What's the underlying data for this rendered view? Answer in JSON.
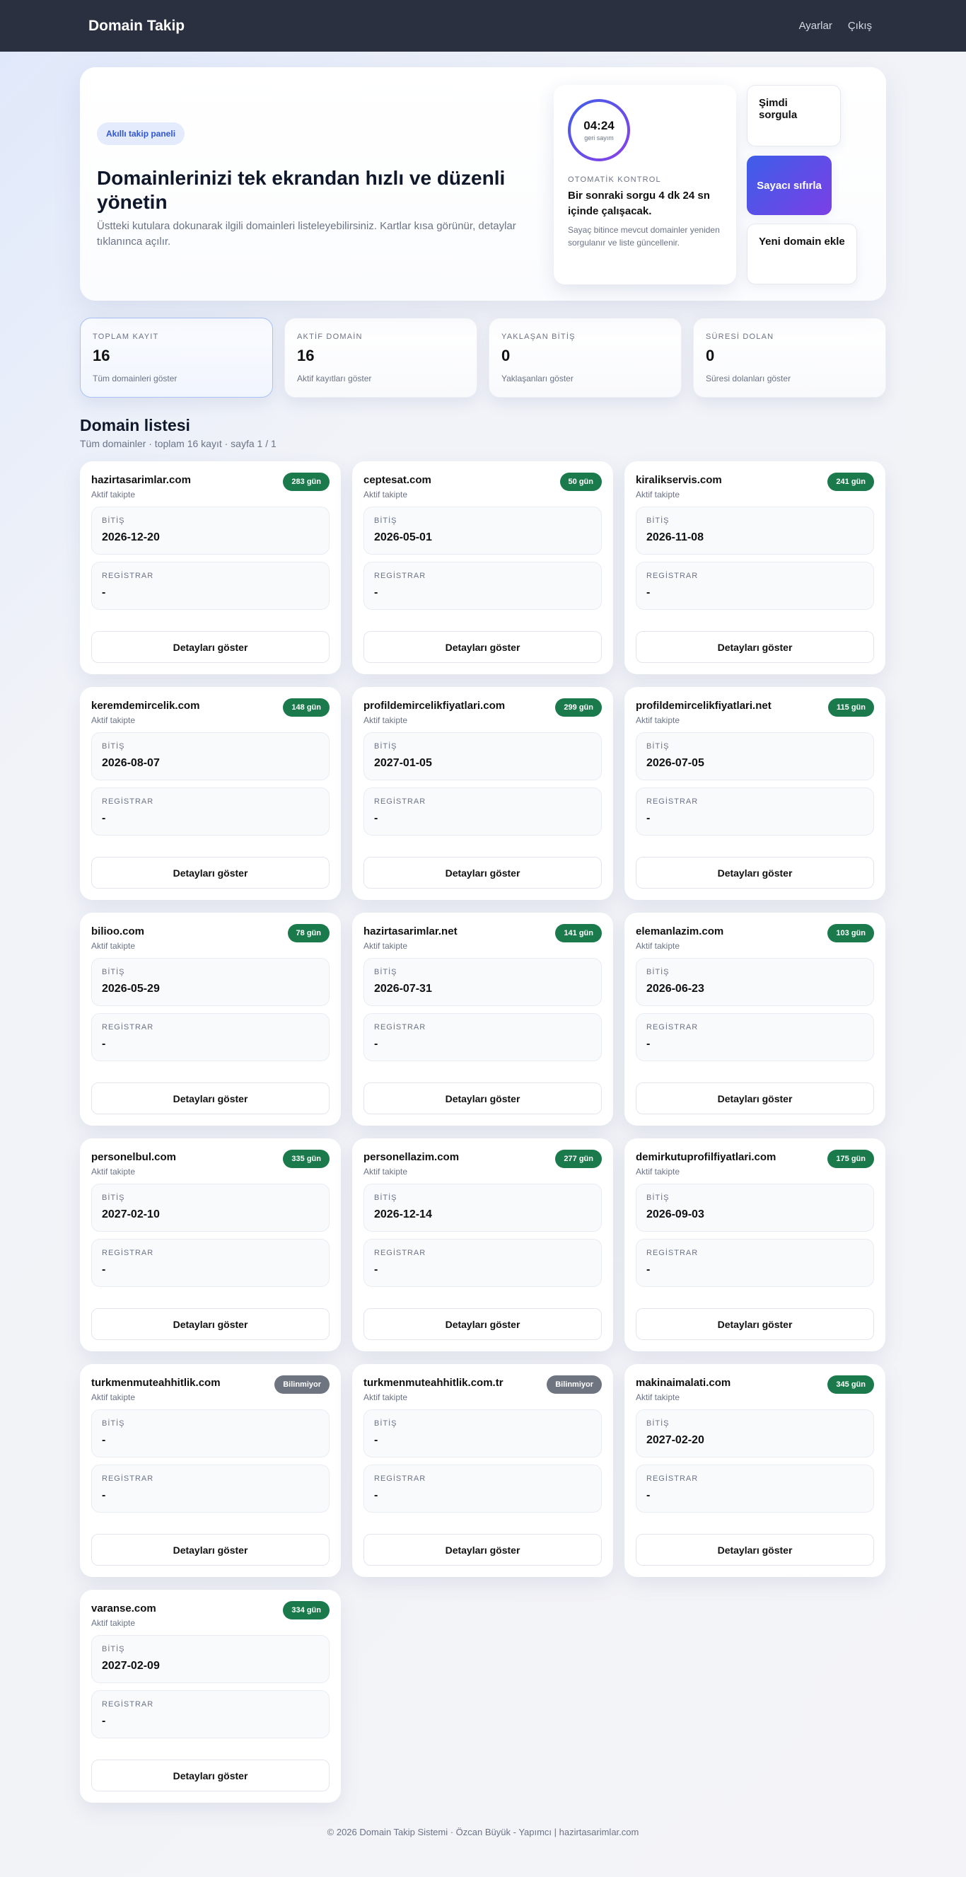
{
  "topbar": {
    "brand": "Domain Takip",
    "nav": [
      "Ayarlar",
      "Çıkış"
    ]
  },
  "hero": {
    "pill": "Akıllı takip paneli",
    "title": "Domainlerinizi tek ekrandan hızlı ve düzenli yönetin",
    "desc": "Üstteki kutulara dokunarak ilgili domainleri listeleyebilirsiniz. Kartlar kısa görünür, detaylar tıklanınca açılır.",
    "timer": {
      "time": "04:24",
      "time_label": "geri sayım",
      "label": "OTOMATİK KONTROL",
      "main": "Bir sonraki sorgu 4 dk 24 sn içinde çalışacak.",
      "sub": "Sayaç bitince mevcut domainler yeniden sorgulanır ve liste güncellenir."
    },
    "actions": {
      "query": "Şimdi sorgula",
      "reset": "Sayacı sıfırla",
      "add": "Yeni domain ekle"
    }
  },
  "stats": [
    {
      "label": "TOPLAM KAYIT",
      "value": "16",
      "desc": "Tüm domainleri göster"
    },
    {
      "label": "AKTİF DOMAİN",
      "value": "16",
      "desc": "Aktif kayıtları göster"
    },
    {
      "label": "YAKLAŞAN BİTİŞ",
      "value": "0",
      "desc": "Yaklaşanları göster"
    },
    {
      "label": "SÜRESİ DOLAN",
      "value": "0",
      "desc": "Süresi dolanları göster"
    }
  ],
  "list": {
    "title": "Domain listesi",
    "subtitle": "Tüm domainler · toplam 16 kayıt · sayfa 1 / 1",
    "end_label": "BİTİŞ",
    "registrar_label": "REGİSTRAR",
    "detail_label": "Detayları göster",
    "items": [
      {
        "name": "hazirtasarimlar.com",
        "status": "Aktif takipte",
        "badge": "283 gün",
        "unknown": false,
        "end": "2026-12-20",
        "registrar": "-"
      },
      {
        "name": "ceptesat.com",
        "status": "Aktif takipte",
        "badge": "50 gün",
        "unknown": false,
        "end": "2026-05-01",
        "registrar": "-"
      },
      {
        "name": "kiralikservis.com",
        "status": "Aktif takipte",
        "badge": "241 gün",
        "unknown": false,
        "end": "2026-11-08",
        "registrar": "-"
      },
      {
        "name": "keremdemircelik.com",
        "status": "Aktif takipte",
        "badge": "148 gün",
        "unknown": false,
        "end": "2026-08-07",
        "registrar": "-"
      },
      {
        "name": "profildemircelikfiyatlari.com",
        "status": "Aktif takipte",
        "badge": "299 gün",
        "unknown": false,
        "end": "2027-01-05",
        "registrar": "-"
      },
      {
        "name": "profildemircelikfiyatlari.net",
        "status": "Aktif takipte",
        "badge": "115 gün",
        "unknown": false,
        "end": "2026-07-05",
        "registrar": "-"
      },
      {
        "name": "bilioo.com",
        "status": "Aktif takipte",
        "badge": "78 gün",
        "unknown": false,
        "end": "2026-05-29",
        "registrar": "-"
      },
      {
        "name": "hazirtasarimlar.net",
        "status": "Aktif takipte",
        "badge": "141 gün",
        "unknown": false,
        "end": "2026-07-31",
        "registrar": "-"
      },
      {
        "name": "elemanlazim.com",
        "status": "Aktif takipte",
        "badge": "103 gün",
        "unknown": false,
        "end": "2026-06-23",
        "registrar": "-"
      },
      {
        "name": "personelbul.com",
        "status": "Aktif takipte",
        "badge": "335 gün",
        "unknown": false,
        "end": "2027-02-10",
        "registrar": "-"
      },
      {
        "name": "personellazim.com",
        "status": "Aktif takipte",
        "badge": "277 gün",
        "unknown": false,
        "end": "2026-12-14",
        "registrar": "-"
      },
      {
        "name": "demirkutuprofilfiyatlari.com",
        "status": "Aktif takipte",
        "badge": "175 gün",
        "unknown": false,
        "end": "2026-09-03",
        "registrar": "-"
      },
      {
        "name": "turkmenmuteahhitlik.com",
        "status": "Aktif takipte",
        "badge": "Bilinmiyor",
        "unknown": true,
        "end": "-",
        "registrar": "-"
      },
      {
        "name": "turkmenmuteahhitlik.com.tr",
        "status": "Aktif takipte",
        "badge": "Bilinmiyor",
        "unknown": true,
        "end": "-",
        "registrar": "-"
      },
      {
        "name": "makinaimalati.com",
        "status": "Aktif takipte",
        "badge": "345 gün",
        "unknown": false,
        "end": "2027-02-20",
        "registrar": "-"
      },
      {
        "name": "varanse.com",
        "status": "Aktif takipte",
        "badge": "334 gün",
        "unknown": false,
        "end": "2027-02-09",
        "registrar": "-"
      }
    ]
  },
  "footer": "© 2026 Domain Takip Sistemi · Özcan Büyük - Yapımcı | hazirtasarimlar.com",
  "colors": {
    "accent": "#3d5ee8",
    "accent2": "#7b3fe6",
    "badge_ok": "#1b7a4c",
    "badge_unknown": "#6e7480",
    "topbar": "#2b3040"
  }
}
